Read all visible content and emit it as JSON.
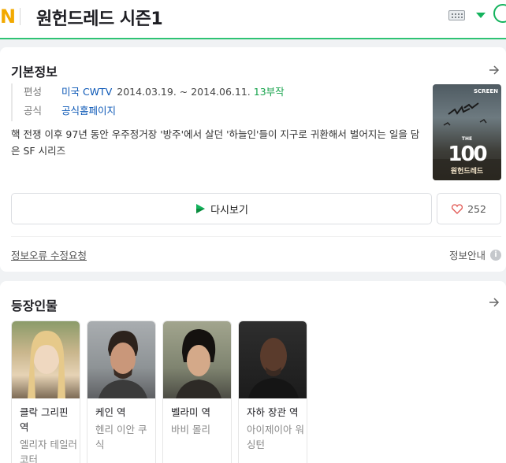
{
  "header": {
    "logo_fragment": "N",
    "title": "원헌드레드 시즌1",
    "icons": [
      "keyboard-icon",
      "dropdown-arrow-icon",
      "circle-icon"
    ]
  },
  "info": {
    "section_title": "기본정보",
    "rows": [
      {
        "label": "편성",
        "network": "미국 CWTV",
        "dates": "2014.03.19. ~ 2014.06.11.",
        "episodes": "13부작"
      },
      {
        "label": "공식",
        "link": "공식홈페이지"
      }
    ],
    "description": "핵 전쟁 이후 97년 동안 우주정거장 '방주'에서 살던 '하늘인'들이 지구로 귀환해서 벌어지는 일을 담은 SF 시리즈",
    "poster": {
      "badge": "SCREEN",
      "logo": "100",
      "subtitle": "원헌드레드",
      "small_text": "THE"
    },
    "rewatch_label": "다시보기",
    "like_count": "252",
    "report_link": "정보오류 수정요청",
    "guide_label": "정보안내"
  },
  "cast": {
    "section_title": "등장인물",
    "members": [
      {
        "role": "클락 그리핀 역",
        "actor": "엘리자 테일러 코터"
      },
      {
        "role": "케인 역",
        "actor": "헨리 이안 쿠식"
      },
      {
        "role": "벨라미 역",
        "actor": "바비 몰리"
      },
      {
        "role": "자하 장관 역",
        "actor": "아이제이아 워싱턴"
      }
    ]
  },
  "colors": {
    "accent_green": "#14b35d",
    "link_blue": "#0b57b6",
    "logo_yellow": "#f2a900"
  }
}
